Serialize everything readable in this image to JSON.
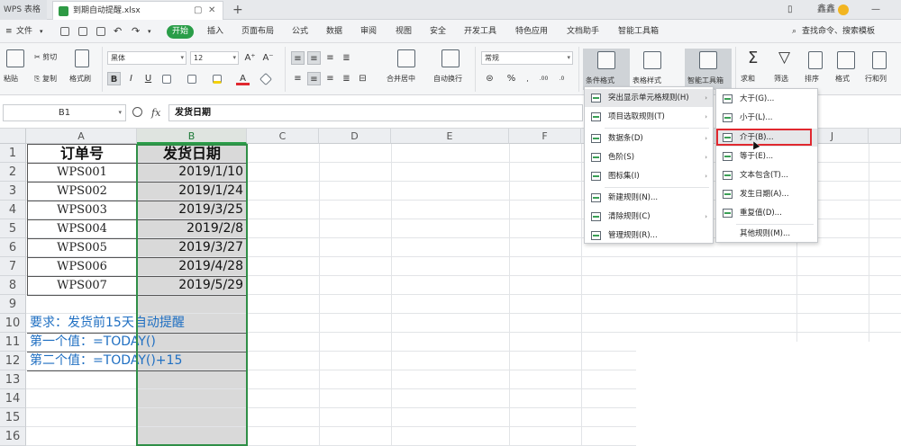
{
  "titlebar": {
    "app_name": "WPS 表格",
    "doc_tab": "到期自动提醒.xlsx",
    "plus": "+",
    "user": "鑫鑫",
    "tab_restore": "▢",
    "tab_close": "✕"
  },
  "menubar": {
    "file": "文件",
    "items": [
      "开始",
      "插入",
      "页面布局",
      "公式",
      "数据",
      "审阅",
      "视图",
      "安全",
      "开发工具",
      "特色应用",
      "文档助手",
      "智能工具箱"
    ],
    "search": "查找命令、搜索模板"
  },
  "ribbon": {
    "paste": "粘贴",
    "cut": "剪切",
    "copy": "复制",
    "format_painter": "格式刷",
    "font_name": "黑体",
    "font_size": "12",
    "font_grow": "A⁺",
    "font_shrink": "A⁻",
    "bold": "B",
    "italic": "I",
    "underline": "U",
    "merge_center": "合并居中",
    "auto_wrap": "自动换行",
    "number_format": "常规",
    "percent": "%",
    "conditional_format": "条件格式",
    "table_style": "表格样式",
    "smart_toolbox": "智能工具箱",
    "sum": "求和",
    "filter": "筛选",
    "sort": "排序",
    "format": "格式",
    "rows_cols": "行和列"
  },
  "formulabar": {
    "cell_ref": "B1",
    "fx": "fx",
    "content": "发货日期"
  },
  "sheet": {
    "columns": [
      "A",
      "B",
      "C",
      "D",
      "E",
      "F",
      "J"
    ],
    "rows": [
      "1",
      "2",
      "3",
      "4",
      "5",
      "6",
      "7",
      "8",
      "9",
      "10",
      "11",
      "12",
      "13",
      "14",
      "15",
      "16"
    ],
    "header": {
      "order_no": "订单号",
      "ship_date": "发货日期"
    },
    "orders": [
      {
        "id": "WPS001",
        "date": "2019/1/10"
      },
      {
        "id": "WPS002",
        "date": "2019/1/24"
      },
      {
        "id": "WPS003",
        "date": "2019/3/25"
      },
      {
        "id": "WPS004",
        "date": "2019/2/8"
      },
      {
        "id": "WPS005",
        "date": "2019/3/27"
      },
      {
        "id": "WPS006",
        "date": "2019/4/28"
      },
      {
        "id": "WPS007",
        "date": "2019/5/29"
      }
    ],
    "notes": [
      "要求：发货前15天自动提醒",
      "第一个值：=TODAY()",
      "第二个值：=TODAY()+15"
    ]
  },
  "cf_menu": {
    "items": [
      {
        "label": "突出显示单元格规则(H)",
        "arrow": "›"
      },
      {
        "label": "项目选取规则(T)",
        "arrow": "›"
      },
      {
        "label": "数据条(D)",
        "arrow": "›"
      },
      {
        "label": "色阶(S)",
        "arrow": "›"
      },
      {
        "label": "图标集(I)",
        "arrow": "›"
      },
      {
        "label": "新建规则(N)...",
        "arrow": ""
      },
      {
        "label": "清除规则(C)",
        "arrow": "›"
      },
      {
        "label": "管理规则(R)...",
        "arrow": ""
      }
    ]
  },
  "sub_menu": {
    "items": [
      "大于(G)...",
      "小于(L)...",
      "介于(B)...",
      "等于(E)...",
      "文本包含(T)...",
      "发生日期(A)...",
      "重复值(D)...",
      "其他规则(M)..."
    ]
  }
}
